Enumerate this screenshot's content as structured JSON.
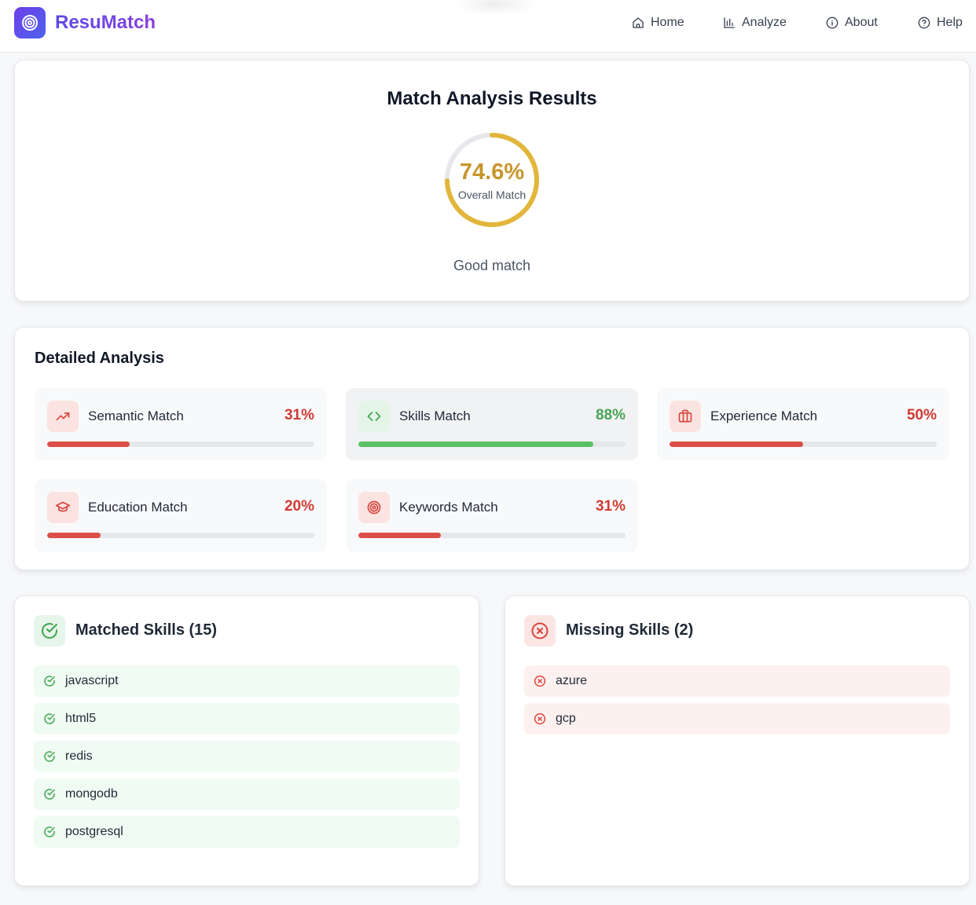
{
  "app": {
    "name": "ResuMatch",
    "logo_icon": "target-icon",
    "brand_gradient": [
      "#6d3ee6",
      "#4d63f0"
    ]
  },
  "nav": [
    {
      "label": "Home",
      "icon": "home-icon"
    },
    {
      "label": "Analyze",
      "icon": "bar-chart-icon"
    },
    {
      "label": "About",
      "icon": "info-icon"
    },
    {
      "label": "Help",
      "icon": "help-circle-icon"
    }
  ],
  "results": {
    "title": "Match Analysis Results",
    "overall_percent": "74.6%",
    "overall_value": 0.746,
    "overall_label": "Overall Match",
    "verdict": "Good match",
    "gauge_color": "#e2b63b"
  },
  "detail": {
    "title": "Detailed Analysis",
    "metrics": [
      {
        "name": "Semantic Match",
        "value": "31%",
        "fraction": 0.31,
        "icon": "trending-up-icon",
        "status": "low"
      },
      {
        "name": "Skills Match",
        "value": "88%",
        "fraction": 0.88,
        "icon": "code-icon",
        "status": "high"
      },
      {
        "name": "Experience Match",
        "value": "50%",
        "fraction": 0.5,
        "icon": "briefcase-icon",
        "status": "low"
      },
      {
        "name": "Education Match",
        "value": "20%",
        "fraction": 0.2,
        "icon": "graduation-cap-icon",
        "status": "low"
      },
      {
        "name": "Keywords Match",
        "value": "31%",
        "fraction": 0.31,
        "icon": "target-icon",
        "status": "low"
      }
    ],
    "colors": {
      "low": "#db4f48",
      "high": "#5bc066"
    }
  },
  "matched": {
    "title": "Matched Skills (15)",
    "icon": "check-circle-icon",
    "items": [
      "javascript",
      "html5",
      "redis",
      "mongodb",
      "postgresql"
    ]
  },
  "missing": {
    "title": "Missing Skills (2)",
    "icon": "x-circle-icon",
    "items": [
      "azure",
      "gcp"
    ]
  }
}
